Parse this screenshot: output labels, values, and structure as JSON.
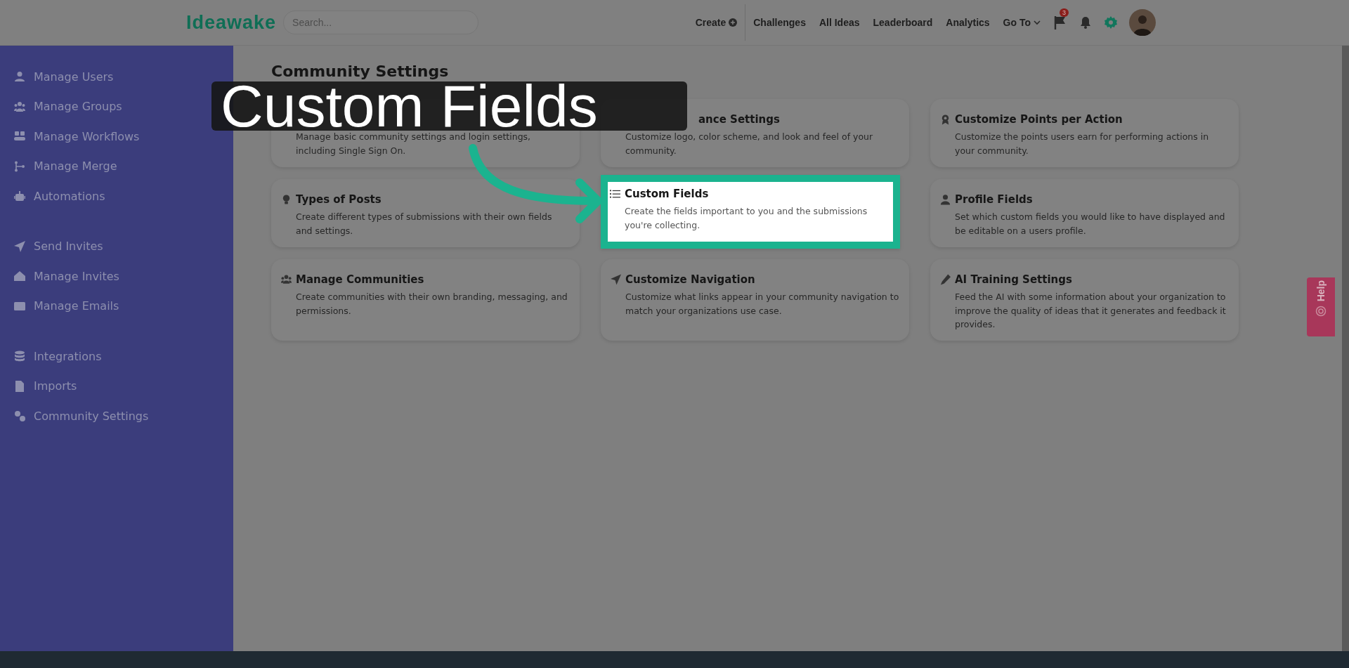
{
  "header": {
    "logo": "Ideawake",
    "search": {
      "placeholder": "Search..."
    },
    "nav": [
      {
        "label": "Create",
        "kind": "create"
      },
      {
        "label": "Challenges",
        "kind": "link"
      },
      {
        "label": "All Ideas",
        "kind": "link"
      },
      {
        "label": "Leaderboard",
        "kind": "link"
      },
      {
        "label": "Analytics",
        "kind": "link"
      },
      {
        "label": "Go To",
        "kind": "dropdown"
      }
    ],
    "notification_badge": "3"
  },
  "sidebar": {
    "sections": [
      {
        "items": [
          {
            "label": "Manage Users"
          },
          {
            "label": "Manage Groups"
          },
          {
            "label": "Manage Workflows"
          },
          {
            "label": "Manage Merge"
          },
          {
            "label": "Automations"
          }
        ]
      },
      {
        "items": [
          {
            "label": "Send Invites"
          },
          {
            "label": "Manage Invites"
          },
          {
            "label": "Manage Emails"
          }
        ]
      },
      {
        "items": [
          {
            "label": "Integrations"
          },
          {
            "label": "Imports"
          },
          {
            "label": "Community Settings"
          }
        ]
      }
    ]
  },
  "page_title": "Community Settings",
  "cards": [
    {
      "description": "Manage basic community settings and login settings, including Single Sign On.",
      "highlighted": false
    },
    {
      "title": "ance Settings",
      "title_cut": true,
      "description": "Customize logo, color scheme, and look and feel of your community.",
      "highlighted": false
    },
    {
      "title": "Customize Points per Action",
      "description": "Customize the points users earn for performing actions in your community.",
      "highlighted": false
    },
    {
      "title": "Types of Posts",
      "description": "Create different types of submissions with their own fields and settings.",
      "highlighted": false
    },
    {
      "title": "Custom Fields",
      "description": "Create the fields important to you and the submissions you're collecting.",
      "highlighted": true
    },
    {
      "title": "Profile Fields",
      "description": "Set which custom fields you would like to have displayed and be editable on a users profile.",
      "highlighted": false
    },
    {
      "title": "Manage Communities",
      "description": "Create communities with their own branding, messaging, and permissions.",
      "highlighted": false
    },
    {
      "title": "Customize Navigation",
      "description": "Customize what links appear in your community navigation to match your organizations use case.",
      "highlighted": false
    },
    {
      "title": "AI Training Settings",
      "description": "Feed the AI with some information about your organization to improve the quality of ideas that it generates and feedback it provides.",
      "highlighted": false
    }
  ],
  "caption": "Custom Fields",
  "help_tab": {
    "label": "Help"
  }
}
